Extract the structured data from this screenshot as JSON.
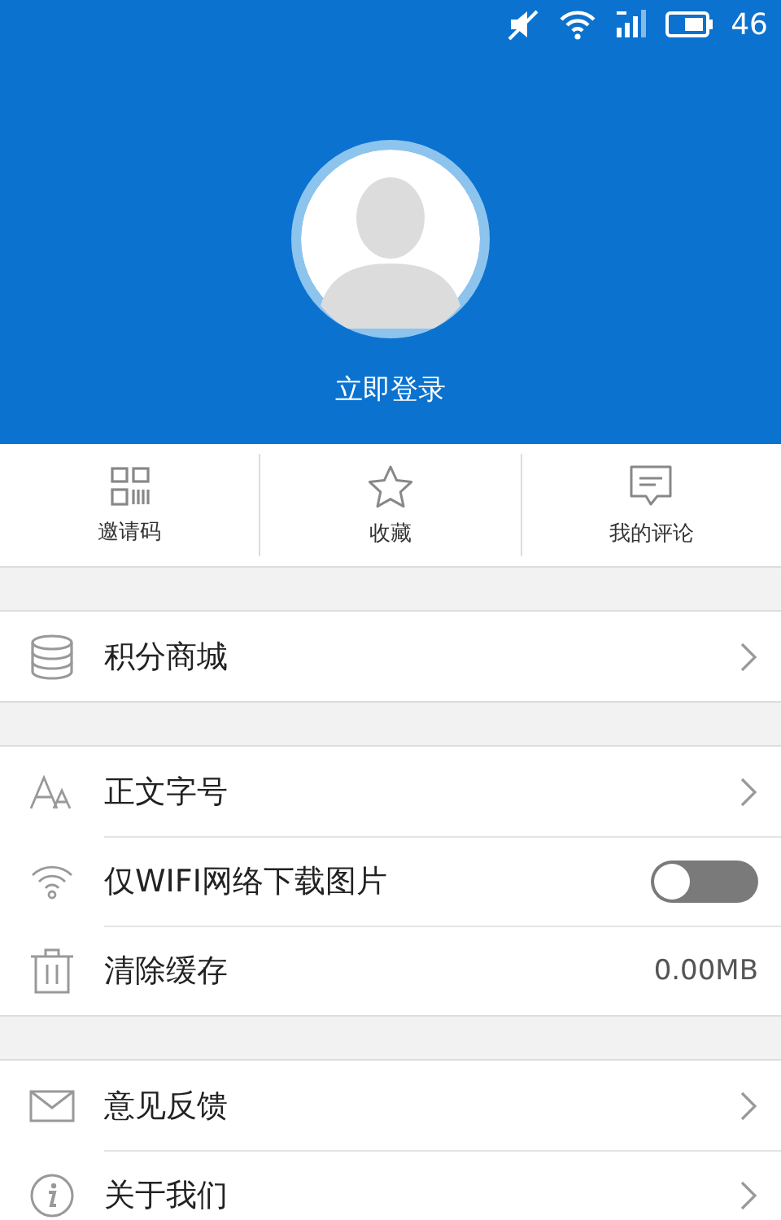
{
  "status_bar": {
    "battery_text": "46"
  },
  "profile": {
    "login_label": "立即登录"
  },
  "shortcuts": [
    {
      "label": "邀请码"
    },
    {
      "label": "收藏"
    },
    {
      "label": "我的评论"
    }
  ],
  "groups": [
    {
      "items": [
        {
          "kind": "link",
          "label": "积分商城"
        }
      ]
    },
    {
      "items": [
        {
          "kind": "link",
          "label": "正文字号"
        },
        {
          "kind": "toggle",
          "label": "仅WIFI网络下载图片",
          "on": false
        },
        {
          "kind": "value",
          "label": "清除缓存",
          "value": "0.00MB"
        }
      ]
    },
    {
      "items": [
        {
          "kind": "link",
          "label": "意见反馈"
        },
        {
          "kind": "link",
          "label": "关于我们"
        }
      ]
    }
  ]
}
